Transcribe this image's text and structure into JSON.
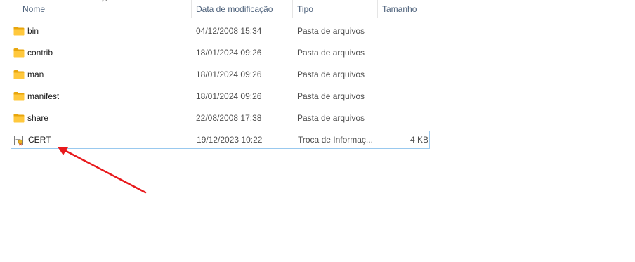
{
  "columns": {
    "name": "Nome",
    "date": "Data de modificação",
    "type": "Tipo",
    "size": "Tamanho"
  },
  "files": [
    {
      "name": "bin",
      "date": "04/12/2008 15:34",
      "type": "Pasta de arquivos",
      "size": "",
      "icon": "folder-icon"
    },
    {
      "name": "contrib",
      "date": "18/01/2024 09:26",
      "type": "Pasta de arquivos",
      "size": "",
      "icon": "folder-icon"
    },
    {
      "name": "man",
      "date": "18/01/2024 09:26",
      "type": "Pasta de arquivos",
      "size": "",
      "icon": "folder-icon"
    },
    {
      "name": "manifest",
      "date": "18/01/2024 09:26",
      "type": "Pasta de arquivos",
      "size": "",
      "icon": "folder-icon"
    },
    {
      "name": "share",
      "date": "22/08/2008 17:38",
      "type": "Pasta de arquivos",
      "size": "",
      "icon": "folder-icon"
    },
    {
      "name": "CERT",
      "date": "19/12/2023 10:22",
      "type": "Troca de Informaç...",
      "size": "4 KB",
      "icon": "certificate-icon",
      "selected": true
    }
  ],
  "annotation": {
    "icon": "red-arrow-annotation",
    "color": "#e8191c"
  },
  "colors": {
    "folder": "#ffc83d",
    "selection_border": "#99c9ef"
  }
}
